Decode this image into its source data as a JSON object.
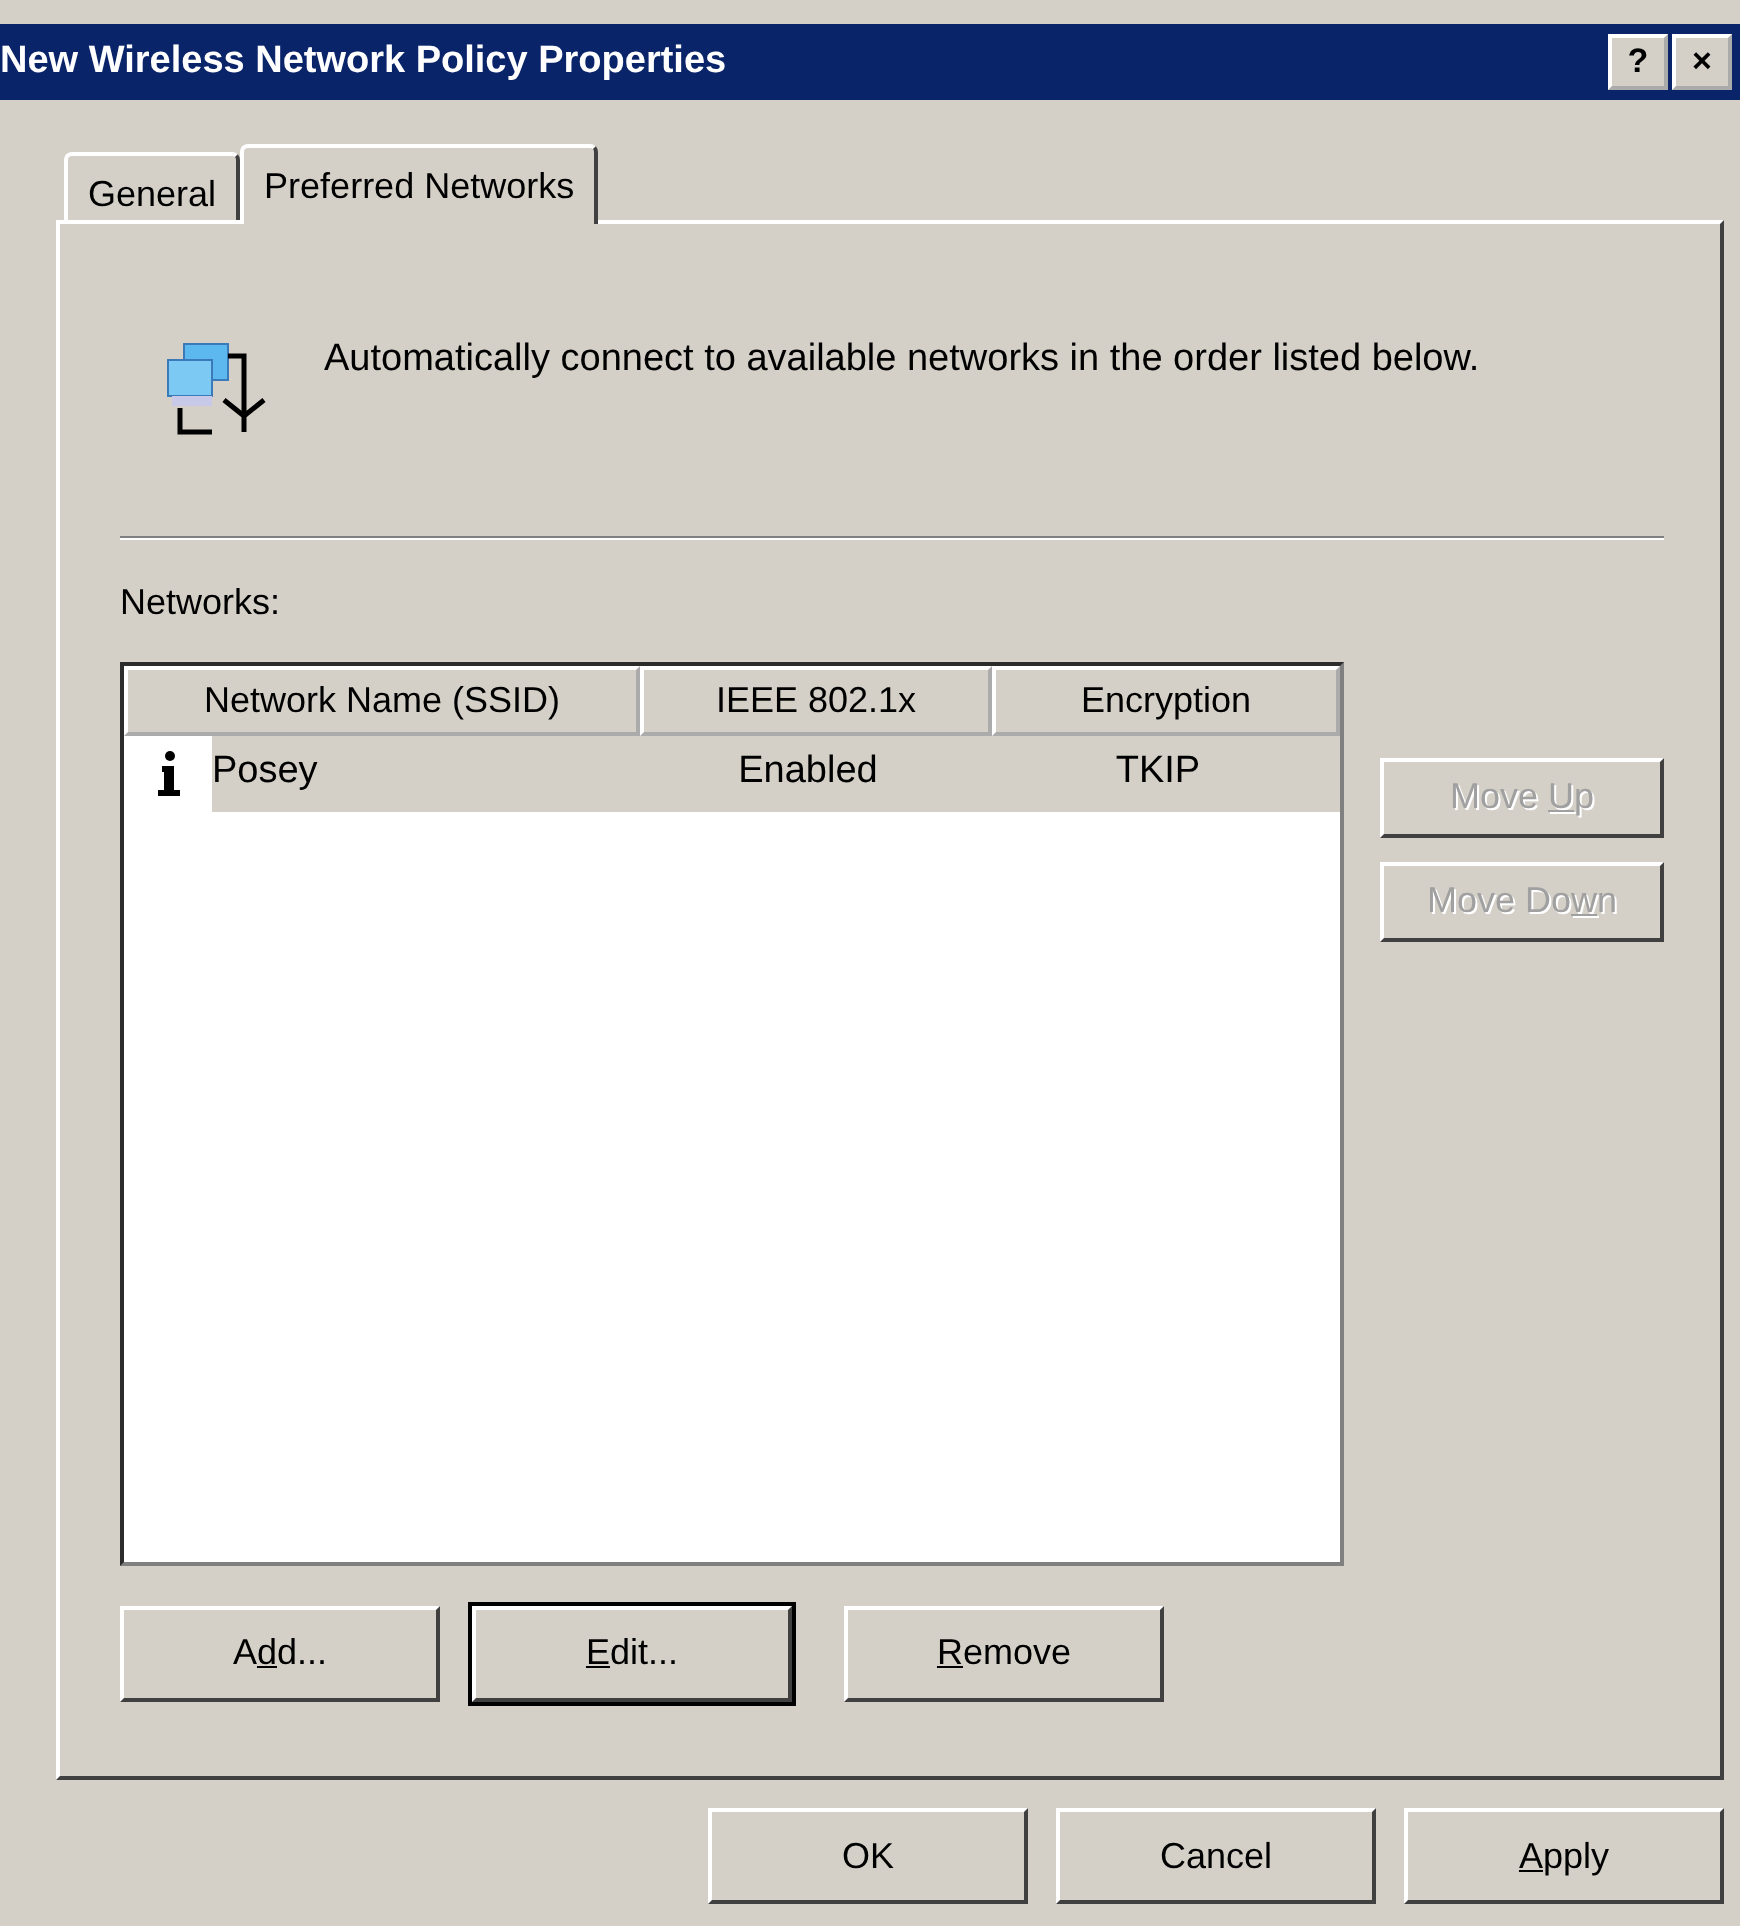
{
  "window": {
    "title": "New Wireless Network Policy Properties",
    "title_buttons": [
      "?",
      "×"
    ]
  },
  "tabs": [
    {
      "label": "General",
      "selected": false
    },
    {
      "label": "Preferred Networks",
      "selected": true
    }
  ],
  "intro": "Automatically connect to available networks in the order listed below.",
  "networks_label": "Networks:",
  "table": {
    "columns": [
      "Network Name (SSID)",
      "IEEE 802.1x",
      "Encryption"
    ],
    "rows": [
      {
        "cells": [
          "Posey",
          "Enabled",
          "TKIP"
        ],
        "selected": true
      }
    ]
  },
  "side_buttons": [
    {
      "before": "Move ",
      "key": "U",
      "after": "p",
      "disabled": true
    },
    {
      "before": "Move Do",
      "key": "w",
      "after": "n",
      "disabled": true
    }
  ],
  "list_buttons": [
    {
      "before": "A",
      "key": "d",
      "after": "d...",
      "default": false
    },
    {
      "key": "E",
      "after": "dit...",
      "default": true
    },
    {
      "key": "R",
      "after": "emove",
      "default": false
    }
  ],
  "dialog_buttons": [
    {
      "after": "OK"
    },
    {
      "after": "Cancel"
    },
    {
      "key": "A",
      "after": "pply"
    }
  ]
}
